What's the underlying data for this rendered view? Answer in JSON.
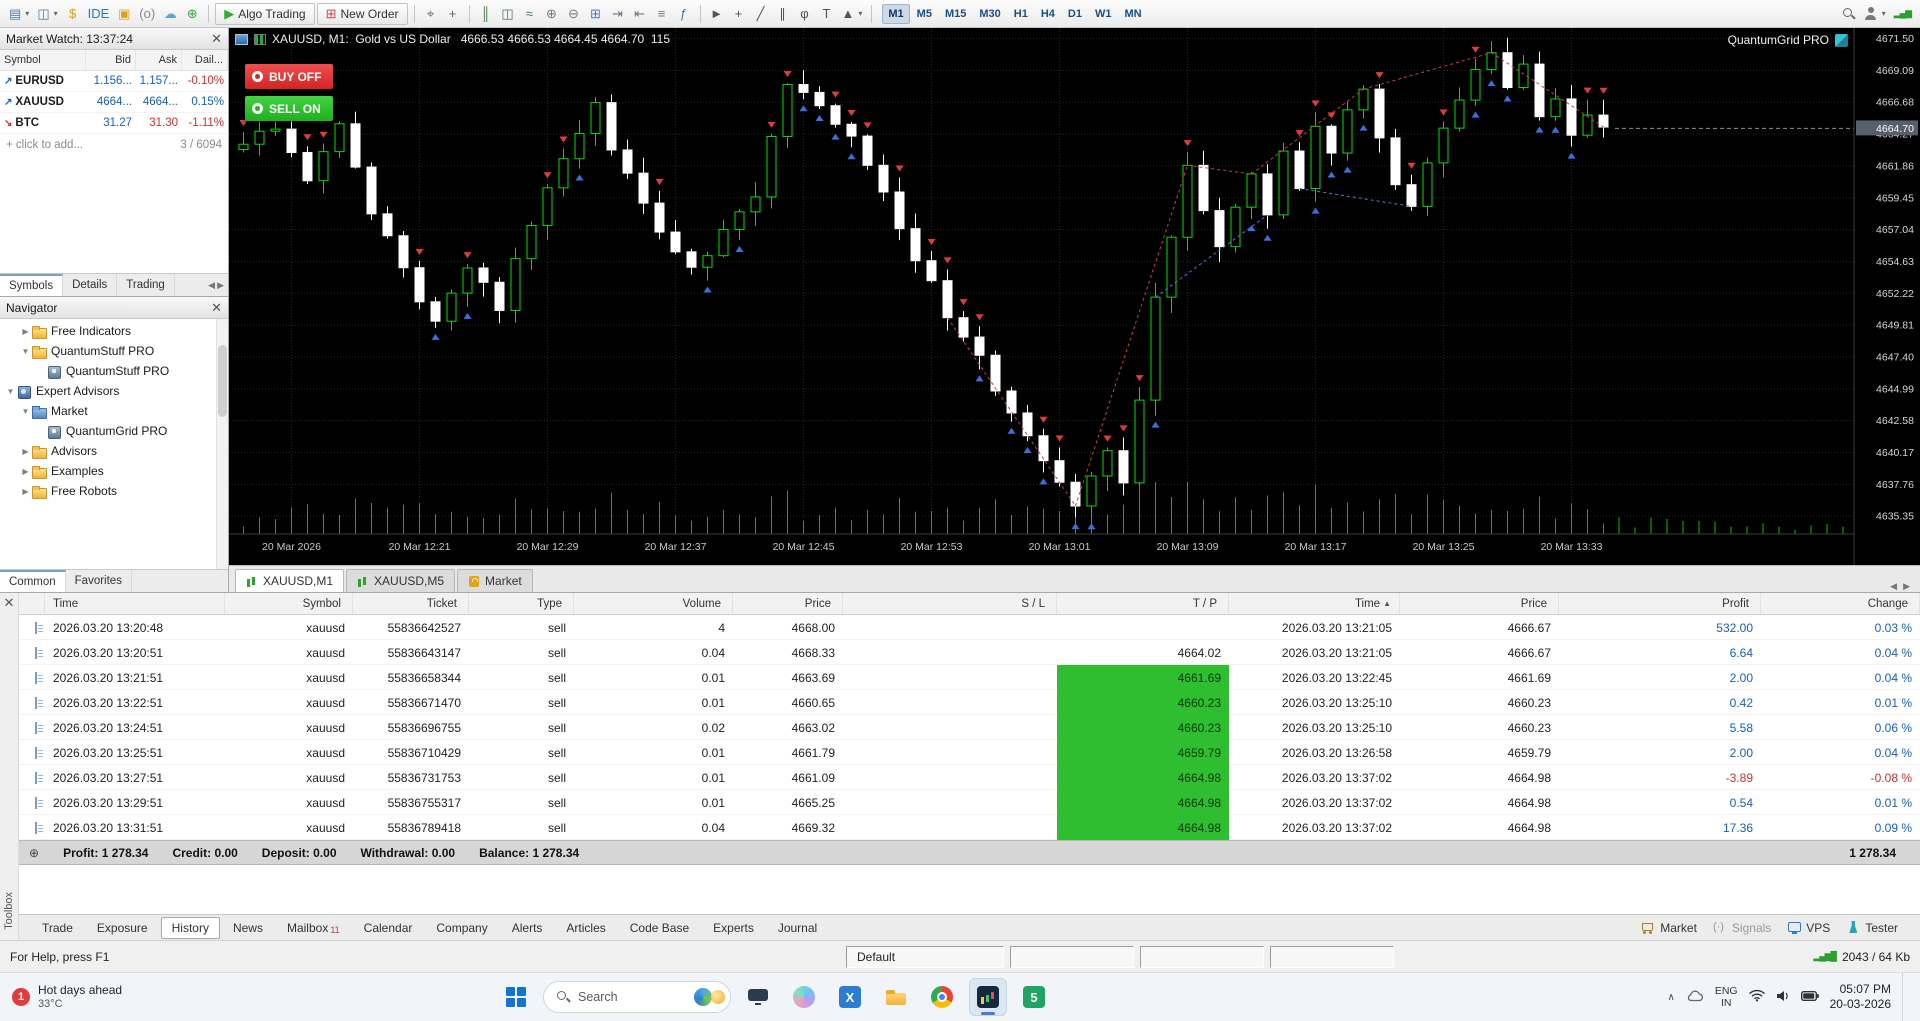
{
  "toolbar": {
    "items": [
      {
        "name": "new-chart-icon",
        "glyph": "▤",
        "color": "#4a7ab5",
        "caret": "▾"
      },
      {
        "name": "profiles-icon",
        "glyph": "◫",
        "color": "#4a7ab5",
        "caret": "▾"
      },
      {
        "name": "deposit-icon",
        "glyph": "$",
        "color": "#e0a013",
        "gcls": "bold"
      },
      {
        "name": "metaeditor-ide-icon",
        "glyph": "IDE",
        "color": "#2b7bb9",
        "gcls": "small"
      },
      {
        "name": "lock-icon",
        "glyph": "▣",
        "color": "#d9a514"
      },
      {
        "name": "broadcast-icon",
        "glyph": "(o)",
        "color": "#8a8a8a",
        "gcls": "small"
      },
      {
        "name": "cloud-icon",
        "glyph": "☁",
        "color": "#58a6d8"
      },
      {
        "name": "add-account-icon",
        "glyph": "⊕",
        "color": "#3aa43a"
      },
      {
        "kind": "sep"
      },
      {
        "name": "algo-trading-button",
        "kind": "btn",
        "glyph": "▶",
        "color": "#2fae2f",
        "label": "Algo Trading"
      },
      {
        "name": "new-order-button",
        "kind": "btn",
        "glyph": "⊞",
        "color": "#d04545",
        "label": "New Order"
      },
      {
        "kind": "sep"
      },
      {
        "name": "cursor-icon",
        "glyph": "⌖",
        "color": "#666666"
      },
      {
        "name": "crosshair-icon",
        "glyph": "+",
        "color": "#666666",
        "gcls": "bold"
      },
      {
        "kind": "sep"
      },
      {
        "name": "bar-chart-icon",
        "glyph": "║",
        "color": "#4a7a4a"
      },
      {
        "name": "candle-chart-icon",
        "glyph": "◫",
        "color": "#4a7a4a"
      },
      {
        "name": "line-chart-icon",
        "glyph": "≈",
        "color": "#4a7a4a"
      },
      {
        "name": "zoom-in-icon",
        "glyph": "⊕",
        "color": "#777777"
      },
      {
        "name": "zoom-out-icon",
        "glyph": "⊖",
        "color": "#777777"
      },
      {
        "name": "grid-icon",
        "glyph": "⊞",
        "color": "#4a7ab5"
      },
      {
        "name": "autoscroll-icon",
        "glyph": "⇥",
        "color": "#667788"
      },
      {
        "name": "chart-shift-icon",
        "glyph": "⇤",
        "color": "#667788"
      },
      {
        "name": "objects-list-icon",
        "glyph": "≡",
        "color": "#777777"
      },
      {
        "name": "indicators-icon",
        "glyph": "ƒ",
        "color": "#3a7ab5",
        "gcls": "bold"
      },
      {
        "kind": "sep"
      },
      {
        "name": "pointer-icon",
        "glyph": "►",
        "color": "#555555"
      },
      {
        "name": "draw-crosshair-icon",
        "glyph": "+",
        "color": "#555555",
        "gcls": "bold"
      },
      {
        "name": "trendline-icon",
        "glyph": "╱",
        "color": "#555555"
      },
      {
        "name": "channel-icon",
        "glyph": "∥",
        "color": "#555555"
      },
      {
        "name": "fibonacci-icon",
        "glyph": "φ",
        "color": "#555555"
      },
      {
        "name": "text-tool-icon",
        "glyph": "T",
        "color": "#555555",
        "gcls": "bold"
      },
      {
        "name": "shapes-icon",
        "glyph": "▲",
        "color": "#555555",
        "caret": "▾"
      },
      {
        "kind": "sep"
      }
    ],
    "timeframes": [
      {
        "label": "M1",
        "cls": "active"
      },
      {
        "label": "M5"
      },
      {
        "label": "M15"
      },
      {
        "label": "M30"
      },
      {
        "label": "H1"
      },
      {
        "label": "H4"
      },
      {
        "label": "D1"
      },
      {
        "label": "W1"
      },
      {
        "label": "MN"
      }
    ]
  },
  "market_watch": {
    "title": "Market Watch: 13:37:24",
    "columns": [
      "Symbol",
      "Bid",
      "Ask",
      "Dail..."
    ],
    "rows": [
      {
        "symbol": "EURUSD",
        "arrow": "↗",
        "acls": "c-blue",
        "bid": "1.156...",
        "bidc": "c-blue",
        "ask": "1.157...",
        "askc": "c-blue",
        "daily": "-0.10%",
        "dailyc": "c-red"
      },
      {
        "symbol": "XAUUSD",
        "arrow": "↗",
        "acls": "c-blue",
        "bid": "4664...",
        "bidc": "c-blue",
        "ask": "4664...",
        "askc": "c-blue",
        "daily": "0.15%",
        "dailyc": "c-blue"
      },
      {
        "symbol": "BTC",
        "arrow": "↘",
        "acls": "c-red",
        "bid": "31.27",
        "bidc": "c-blue",
        "ask": "31.30",
        "askc": "c-red",
        "daily": "-1.11%",
        "dailyc": "c-red"
      }
    ],
    "add_label": "+ click to add...",
    "counter": "3 / 6094",
    "tabs": [
      {
        "label": "Symbols",
        "cls": "active"
      },
      {
        "label": "Details"
      },
      {
        "label": "Trading"
      }
    ]
  },
  "navigator": {
    "title": "Navigator",
    "items": [
      {
        "label": "Free Indicators",
        "depth": 1,
        "exp": "▶",
        "icon": "folder"
      },
      {
        "label": "QuantumStuff PRO",
        "depth": 1,
        "exp": "▼",
        "icon": "folder"
      },
      {
        "label": "QuantumStuff PRO",
        "depth": 2,
        "exp": "",
        "icon": "ea"
      },
      {
        "label": "Expert Advisors",
        "depth": 0,
        "exp": "▼",
        "icon": "earoot"
      },
      {
        "label": "Market",
        "depth": 1,
        "exp": "▼",
        "icon": "market"
      },
      {
        "label": "QuantumGrid PRO",
        "depth": 2,
        "exp": "",
        "icon": "ea"
      },
      {
        "label": "Advisors",
        "depth": 1,
        "exp": "▶",
        "icon": "folder"
      },
      {
        "label": "Examples",
        "depth": 1,
        "exp": "▶",
        "icon": "folder"
      },
      {
        "label": "Free Robots",
        "depth": 1,
        "exp": "▶",
        "icon": "folder"
      }
    ],
    "tabs": [
      {
        "label": "Common",
        "cls": "active"
      },
      {
        "label": "Favorites"
      }
    ]
  },
  "chart": {
    "header": "XAUUSD, M1:  Gold vs US Dollar   4666.53 4666.53 4664.45 4664.70  115",
    "buy_button": "BUY OFF",
    "sell_button": "SELL ON",
    "watermark": "QuantumGrid PRO",
    "tabs": [
      {
        "label": "XAUUSD,M1",
        "cls": "active",
        "icon": "chart"
      },
      {
        "label": "XAUUSD,M5",
        "icon": "chart"
      },
      {
        "label": "Market",
        "icon": "market"
      }
    ]
  },
  "chart_data": {
    "type": "candlestick",
    "symbol": "XAUUSD",
    "timeframe": "M1",
    "y_range": [
      4634.0,
      4672.3
    ],
    "y_ticks": [
      4671.5,
      4669.09,
      4666.68,
      4664.27,
      4661.86,
      4659.45,
      4657.04,
      4654.63,
      4652.22,
      4649.81,
      4647.4,
      4644.99,
      4642.58,
      4640.17,
      4637.76,
      4635.35
    ],
    "x_ticks": [
      [
        "20 Mar 2026",
        3
      ],
      [
        "20 Mar 12:21",
        11
      ],
      [
        "20 Mar 12:29",
        19
      ],
      [
        "20 Mar 12:37",
        27
      ],
      [
        "20 Mar 12:45",
        35
      ],
      [
        "20 Mar 12:53",
        43
      ],
      [
        "20 Mar 13:01",
        51
      ],
      [
        "20 Mar 13:09",
        59
      ],
      [
        "20 Mar 13:17",
        67
      ],
      [
        "20 Mar 13:25",
        75
      ],
      [
        "20 Mar 13:33",
        83
      ]
    ],
    "current_price": 4664.7,
    "candle_count": 86,
    "close_waypoints": [
      [
        0,
        4663.2
      ],
      [
        2,
        4665.0
      ],
      [
        4,
        4661.2
      ],
      [
        6,
        4664.6
      ],
      [
        8,
        4658.5
      ],
      [
        10,
        4654.0
      ],
      [
        12,
        4649.8
      ],
      [
        14,
        4654.3
      ],
      [
        16,
        4651.2
      ],
      [
        18,
        4657.5
      ],
      [
        20,
        4662.0
      ],
      [
        22,
        4666.2
      ],
      [
        24,
        4660.8
      ],
      [
        26,
        4656.8
      ],
      [
        28,
        4654.2
      ],
      [
        30,
        4656.8
      ],
      [
        32,
        4659.5
      ],
      [
        34,
        4668.3
      ],
      [
        36,
        4666.2
      ],
      [
        38,
        4663.8
      ],
      [
        40,
        4659.5
      ],
      [
        42,
        4654.8
      ],
      [
        44,
        4650.5
      ],
      [
        46,
        4647.0
      ],
      [
        48,
        4642.8
      ],
      [
        50,
        4639.2
      ],
      [
        52,
        4636.3
      ],
      [
        54,
        4640.8
      ],
      [
        55,
        4638.2
      ],
      [
        56,
        4644.5
      ],
      [
        57,
        4651.5
      ],
      [
        58,
        4656.8
      ],
      [
        59,
        4662.3
      ],
      [
        60,
        4658.8
      ],
      [
        61,
        4655.6
      ],
      [
        62,
        4658.6
      ],
      [
        63,
        4661.2
      ],
      [
        64,
        4658.2
      ],
      [
        65,
        4663.0
      ],
      [
        66,
        4660.6
      ],
      [
        67,
        4665.4
      ],
      [
        68,
        4662.8
      ],
      [
        69,
        4666.0
      ],
      [
        70,
        4668.0
      ],
      [
        71,
        4664.4
      ],
      [
        72,
        4660.8
      ],
      [
        73,
        4658.4
      ],
      [
        74,
        4661.6
      ],
      [
        75,
        4664.2
      ],
      [
        76,
        4666.6
      ],
      [
        77,
        4669.2
      ],
      [
        78,
        4670.8
      ],
      [
        79,
        4667.6
      ],
      [
        80,
        4669.4
      ],
      [
        81,
        4665.8
      ],
      [
        82,
        4667.4
      ],
      [
        83,
        4663.8
      ],
      [
        84,
        4666.2
      ],
      [
        85,
        4664.7
      ]
    ],
    "connectors": [
      [
        44,
        52,
        "r"
      ],
      [
        52,
        59,
        "r"
      ],
      [
        59,
        63,
        "r"
      ],
      [
        63,
        70,
        "r"
      ],
      [
        70,
        78,
        "r"
      ],
      [
        78,
        85,
        "r"
      ],
      [
        57,
        64,
        "b"
      ],
      [
        66,
        73,
        "b"
      ]
    ]
  },
  "history": {
    "columns": [
      {
        "label": "Time"
      },
      {
        "label": "Symbol"
      },
      {
        "label": "Ticket"
      },
      {
        "label": "Type"
      },
      {
        "label": "Volume"
      },
      {
        "label": "Price"
      },
      {
        "label": "S / L"
      },
      {
        "label": "T / P"
      },
      {
        "label": "Time",
        "arrow": "▲"
      },
      {
        "label": "Price"
      },
      {
        "label": "Profit"
      },
      {
        "label": "Change"
      }
    ],
    "rows": [
      {
        "time": "2026.03.20 13:20:48",
        "symbol": "xauusd",
        "ticket": "55836642527",
        "type": "sell",
        "volume": "4",
        "price": "4668.00",
        "sl": "",
        "tp": "",
        "tp_cls": "",
        "time2": "2026.03.20 13:21:05",
        "price2": "4666.67",
        "profit": "532.00",
        "profit_cls": "c-blue",
        "change": "0.03 %",
        "change_cls": "c-blue"
      },
      {
        "time": "2026.03.20 13:20:51",
        "symbol": "xauusd",
        "ticket": "55836643147",
        "type": "sell",
        "volume": "0.04",
        "price": "4668.33",
        "sl": "",
        "tp": "4664.02",
        "tp_cls": "",
        "time2": "2026.03.20 13:21:05",
        "price2": "4666.67",
        "profit": "6.64",
        "profit_cls": "c-blue",
        "change": "0.04 %",
        "change_cls": "c-blue"
      },
      {
        "time": "2026.03.20 13:21:51",
        "symbol": "xauusd",
        "ticket": "55836658344",
        "type": "sell",
        "volume": "0.01",
        "price": "4663.69",
        "sl": "",
        "tp": "4661.69",
        "tp_cls": "tp-green",
        "time2": "2026.03.20 13:22:45",
        "price2": "4661.69",
        "profit": "2.00",
        "profit_cls": "c-blue",
        "change": "0.04 %",
        "change_cls": "c-blue"
      },
      {
        "time": "2026.03.20 13:22:51",
        "symbol": "xauusd",
        "ticket": "55836671470",
        "type": "sell",
        "volume": "0.01",
        "price": "4660.65",
        "sl": "",
        "tp": "4660.23",
        "tp_cls": "tp-green",
        "time2": "2026.03.20 13:25:10",
        "price2": "4660.23",
        "profit": "0.42",
        "profit_cls": "c-blue",
        "change": "0.01 %",
        "change_cls": "c-blue"
      },
      {
        "time": "2026.03.20 13:24:51",
        "symbol": "xauusd",
        "ticket": "55836696755",
        "type": "sell",
        "volume": "0.02",
        "price": "4663.02",
        "sl": "",
        "tp": "4660.23",
        "tp_cls": "tp-green",
        "time2": "2026.03.20 13:25:10",
        "price2": "4660.23",
        "profit": "5.58",
        "profit_cls": "c-blue",
        "change": "0.06 %",
        "change_cls": "c-blue"
      },
      {
        "time": "2026.03.20 13:25:51",
        "symbol": "xauusd",
        "ticket": "55836710429",
        "type": "sell",
        "volume": "0.01",
        "price": "4661.79",
        "sl": "",
        "tp": "4659.79",
        "tp_cls": "tp-green",
        "time2": "2026.03.20 13:26:58",
        "price2": "4659.79",
        "profit": "2.00",
        "profit_cls": "c-blue",
        "change": "0.04 %",
        "change_cls": "c-blue"
      },
      {
        "time": "2026.03.20 13:27:51",
        "symbol": "xauusd",
        "ticket": "55836731753",
        "type": "sell",
        "volume": "0.01",
        "price": "4661.09",
        "sl": "",
        "tp": "4664.98",
        "tp_cls": "tp-green",
        "time2": "2026.03.20 13:37:02",
        "price2": "4664.98",
        "profit": "-3.89",
        "profit_cls": "c-red",
        "change": "-0.08 %",
        "change_cls": "c-red"
      },
      {
        "time": "2026.03.20 13:29:51",
        "symbol": "xauusd",
        "ticket": "55836755317",
        "type": "sell",
        "volume": "0.01",
        "price": "4665.25",
        "sl": "",
        "tp": "4664.98",
        "tp_cls": "tp-green",
        "time2": "2026.03.20 13:37:02",
        "price2": "4664.98",
        "profit": "0.54",
        "profit_cls": "c-blue",
        "change": "0.01 %",
        "change_cls": "c-blue"
      },
      {
        "time": "2026.03.20 13:31:51",
        "symbol": "xauusd",
        "ticket": "55836789418",
        "type": "sell",
        "volume": "0.04",
        "price": "4669.32",
        "sl": "",
        "tp": "4664.98",
        "tp_cls": "tp-green",
        "time2": "2026.03.20 13:37:02",
        "price2": "4664.98",
        "profit": "17.36",
        "profit_cls": "c-blue",
        "change": "0.09 %",
        "change_cls": "c-blue"
      }
    ],
    "summary": {
      "profit": "Profit: 1 278.34",
      "credit": "Credit: 0.00",
      "deposit": "Deposit: 0.00",
      "withdrawal": "Withdrawal: 0.00",
      "balance": "Balance: 1 278.34",
      "total": "1 278.34"
    },
    "rail_title": "Toolbox"
  },
  "footer": {
    "tabs": [
      {
        "label": "Trade"
      },
      {
        "label": "Exposure"
      },
      {
        "label": "History",
        "cls": "active"
      },
      {
        "label": "News"
      },
      {
        "label": "Mailbox",
        "badge": "11"
      },
      {
        "label": "Calendar"
      },
      {
        "label": "Company"
      },
      {
        "label": "Alerts"
      },
      {
        "label": "Articles"
      },
      {
        "label": "Code Base"
      },
      {
        "label": "Experts"
      },
      {
        "label": "Journal"
      }
    ],
    "right": [
      {
        "label": "Market",
        "icon": "market"
      },
      {
        "label": "Signals",
        "icon": "signals",
        "cls": "dim"
      },
      {
        "label": "VPS",
        "icon": "vps"
      },
      {
        "label": "Tester",
        "icon": "tester"
      }
    ]
  },
  "status_bar": {
    "help": "For Help, press F1",
    "profile": "Default",
    "traffic": "2043 / 64 Kb"
  },
  "taskbar": {
    "badge": "1",
    "weather_title": "Hot days ahead",
    "weather_temp": "33°C",
    "search": "Search",
    "apps": [
      {
        "name": "desktop-app-icon",
        "icon": "monitor"
      },
      {
        "name": "copilot-app-icon",
        "icon": "copilot"
      },
      {
        "name": "office-app-icon",
        "icon": "officex"
      },
      {
        "name": "file-explorer-icon",
        "icon": "folder"
      },
      {
        "name": "chrome-app-icon",
        "icon": "chrome"
      },
      {
        "name": "metatrader-app-icon",
        "icon": "mt5",
        "cls": "active"
      },
      {
        "name": "wps-app-icon",
        "icon": "wps"
      }
    ],
    "lang_top": "ENG",
    "lang_bottom": "IN",
    "time": "05:07 PM",
    "date": "20-03-2026"
  }
}
